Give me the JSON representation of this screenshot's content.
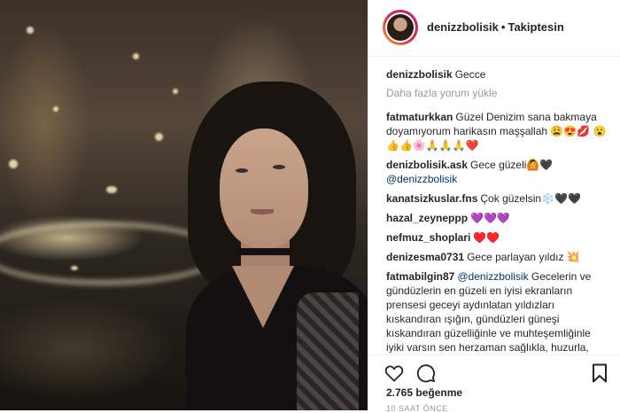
{
  "header": {
    "username": "denizzbolisik",
    "separator": "•",
    "follow_status": "Takiptesin"
  },
  "caption": {
    "user": "denizzbolisik",
    "text": "Gecce"
  },
  "load_more": "Daha fazla yorum yükle",
  "comments": [
    {
      "user": "fatmaturkkan",
      "text": "Güzel Denizim sana bakmaya doyamıyorum harikasın maşşallah 😩😍💋 😮👍👍🌸🙏🙏🙏❤️"
    },
    {
      "user": "denizbolisik.ask",
      "text": "Gece güzeli🙆🖤",
      "mention": "@denizzbolisik"
    },
    {
      "user": "kanatsizkuslar.fns",
      "text": "Çok güzelsin❄️🖤🖤"
    },
    {
      "user": "hazal_zeyneppp",
      "text": "💜💜💜"
    },
    {
      "user": "nefmuz_shoplari",
      "text": "♥️♥️"
    },
    {
      "user": "denizesma0731",
      "text": "Gece parlayan yıldız 💥"
    },
    {
      "user": "fatmabilgin87",
      "mention": "@denizzbolisik",
      "text": "Gecelerin ve gündüzlerin en güzeli en iyisi ekranların prensesi geceyi aydınlatan yıldızları kıskandıran ışığın, gündüzleri güneşi kıskandıran güzelliğinle ve muhteşemliğinle iyiki varsın sen herzaman sağlıkla, huzurla, mutlulukla ve en derin sevgilerle kal güzel"
    }
  ],
  "actions": {
    "like_icon": "heart-icon",
    "comment_icon": "comment-icon",
    "save_icon": "bookmark-icon"
  },
  "likes": "2.765 beğenme",
  "timestamp": "10 SAAT ÖNCE",
  "colors": {
    "text": "#262626",
    "muted": "#999999",
    "mention": "#003569",
    "border": "#efefef"
  }
}
